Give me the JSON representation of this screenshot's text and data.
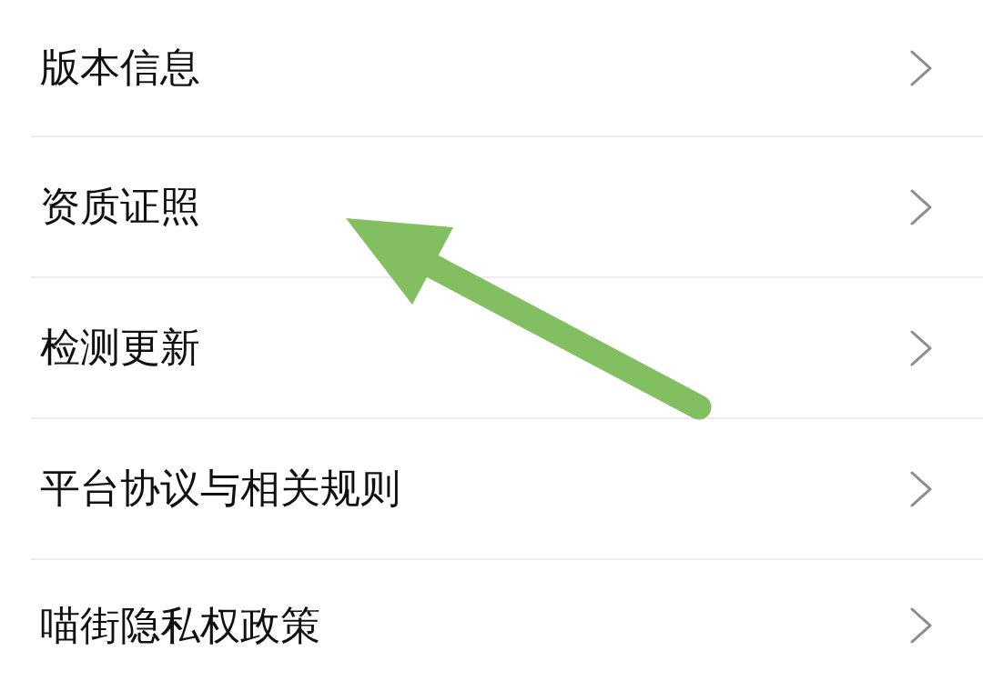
{
  "settings_list": [
    {
      "label": "版本信息"
    },
    {
      "label": "资质证照"
    },
    {
      "label": "检测更新"
    },
    {
      "label": "平台协议与相关规则"
    },
    {
      "label": "喵街隐私权政策"
    }
  ]
}
